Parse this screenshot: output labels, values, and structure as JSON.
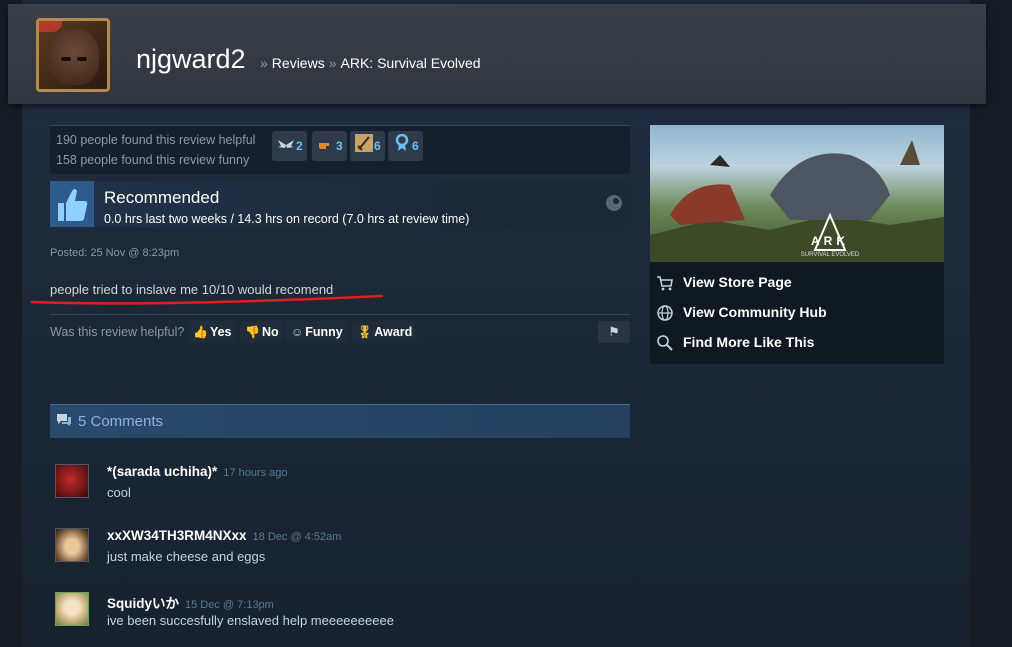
{
  "header": {
    "username": "njgward2",
    "breadcrumb": [
      "Reviews",
      "ARK: Survival Evolved"
    ],
    "separator": "»"
  },
  "helpfulness": {
    "helpful_text": "190 people found this review helpful",
    "funny_text": "158 people found this review funny",
    "awards": [
      {
        "icon": "wings-icon",
        "count": "2"
      },
      {
        "icon": "pointing-hand-icon",
        "count": "3"
      },
      {
        "icon": "sword-icon",
        "count": "6"
      },
      {
        "icon": "ribbon-icon",
        "count": "6"
      }
    ]
  },
  "recommendation": {
    "title": "Recommended",
    "hours": "0.0 hrs last two weeks / 14.3 hrs on record (7.0 hrs at review time)"
  },
  "review": {
    "posted": "Posted: 25 Nov @ 8:23pm",
    "text": "people tried to inslave me 10/10 would recomend"
  },
  "voting": {
    "question": "Was this review helpful?",
    "yes": "Yes",
    "no": "No",
    "funny": "Funny",
    "award": "Award"
  },
  "comments": {
    "header": "5 Comments",
    "items": [
      {
        "author": "*(sarada uchiha)*",
        "time": "17 hours ago",
        "text": "cool"
      },
      {
        "author": "xxXW34TH3RM4NXxx",
        "time": "18 Dec @ 4:52am",
        "text": "just make cheese and eggs"
      },
      {
        "author": "Squidyいか",
        "time": "15 Dec @ 7:13pm",
        "text": "ive been succesfully enslaved help meeeeeeeeee"
      }
    ]
  },
  "game_card": {
    "logo_text": "ARK",
    "logo_sub": "SURVIVAL EVOLVED",
    "links": [
      {
        "icon": "cart-icon",
        "label": "View Store Page"
      },
      {
        "icon": "globe-icon",
        "label": "View Community Hub"
      },
      {
        "icon": "search-icon",
        "label": "Find More Like This"
      }
    ]
  },
  "colors": {
    "accent": "#66c0f4",
    "background": "#1b2838",
    "annotation_red": "#e01e1e"
  }
}
